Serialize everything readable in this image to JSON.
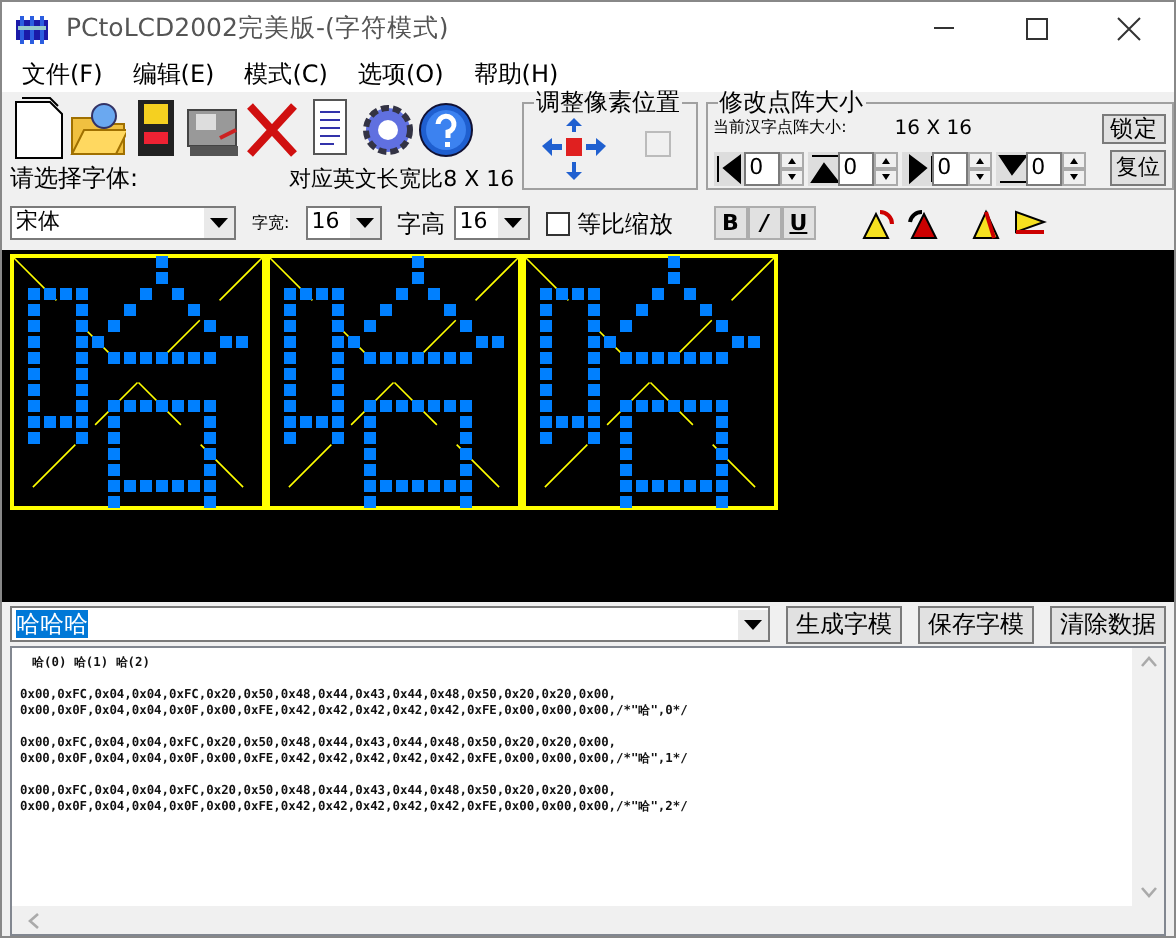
{
  "window": {
    "title": "PCtoLCD2002完美版-(字符模式)"
  },
  "menu": [
    "文件(F)",
    "编辑(E)",
    "模式(C)",
    "选项(O)",
    "帮助(H)"
  ],
  "pixel_position": {
    "title": "调整像素位置"
  },
  "matrix_size": {
    "title": "修改点阵大小",
    "current_label": "当前汉字点阵大小:",
    "current_value": "16 X 16",
    "lock_button": "锁定",
    "reset_button": "复位",
    "spinners": [
      {
        "value": "0"
      },
      {
        "value": "0"
      },
      {
        "value": "0"
      },
      {
        "value": "0"
      }
    ]
  },
  "font": {
    "label": "请选择字体:",
    "value": "宋体",
    "ratio_label": "对应英文长宽比8 X 16",
    "width_label": "字宽:",
    "width_value": "16",
    "height_label": "字高",
    "height_value": "16"
  },
  "proportional": {
    "label": "等比缩放",
    "checked": false
  },
  "style_buttons": [
    "B",
    "/",
    "U"
  ],
  "input": {
    "value": "哈哈哈",
    "highlighted": true
  },
  "buttons": [
    "生成字模",
    "保存字模",
    "清除数据"
  ],
  "output": {
    "index_line": "哈(0)  哈(1)  哈(2)",
    "blocks": [
      {
        "lines": [
          "0x00,0xFC,0x04,0x04,0xFC,0x20,0x50,0x48,0x44,0x43,0x44,0x48,0x50,0x20,0x20,0x00,",
          "0x00,0x0F,0x04,0x04,0x0F,0x00,0xFE,0x42,0x42,0x42,0x42,0x42,0xFE,0x00,0x00,0x00,/*\"哈\",0*/"
        ]
      },
      {
        "lines": [
          "0x00,0xFC,0x04,0x04,0xFC,0x20,0x50,0x48,0x44,0x43,0x44,0x48,0x50,0x20,0x20,0x00,",
          "0x00,0x0F,0x04,0x04,0x0F,0x00,0xFE,0x42,0x42,0x42,0x42,0x42,0xFE,0x00,0x00,0x00,/*\"哈\",1*/"
        ]
      },
      {
        "lines": [
          "0x00,0xFC,0x04,0x04,0xFC,0x20,0x50,0x48,0x44,0x43,0x44,0x48,0x50,0x20,0x20,0x00,",
          "0x00,0x0F,0x04,0x04,0x0F,0x00,0xFE,0x42,0x42,0x42,0x42,0x42,0xFE,0x00,0x00,0x00,/*\"哈\",2*/"
        ]
      }
    ]
  }
}
